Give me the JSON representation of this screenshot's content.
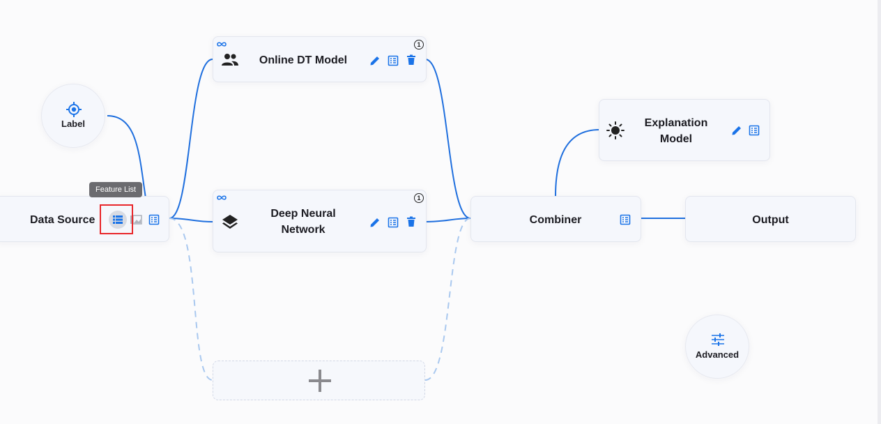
{
  "colors": {
    "accent": "#1a73e8",
    "link": "#1f6fde",
    "link_dashed": "#a9c8ef"
  },
  "label_node": {
    "label": "Label",
    "icon": "target-icon"
  },
  "data_source": {
    "title": "Data Source",
    "tooltip": "Feature List",
    "icons": [
      "feature-list-icon",
      "image-icon",
      "table-icon"
    ]
  },
  "models": [
    {
      "title": "Online DT Model",
      "badge": "1",
      "link_icon": "infinity-icon",
      "icon": "people-icon"
    },
    {
      "title_line1": "Deep Neural",
      "title_line2": "Network",
      "badge": "1",
      "link_icon": "infinity-icon",
      "icon": "layers-icon"
    }
  ],
  "add_model": {
    "icon": "plus-icon"
  },
  "combiner": {
    "title": "Combiner",
    "icon": "table-icon"
  },
  "explanation": {
    "title_line1": "Explanation",
    "title_line2": "Model",
    "icon": "sun-icon"
  },
  "output": {
    "title": "Output"
  },
  "advanced": {
    "label": "Advanced",
    "icon": "sliders-icon"
  }
}
